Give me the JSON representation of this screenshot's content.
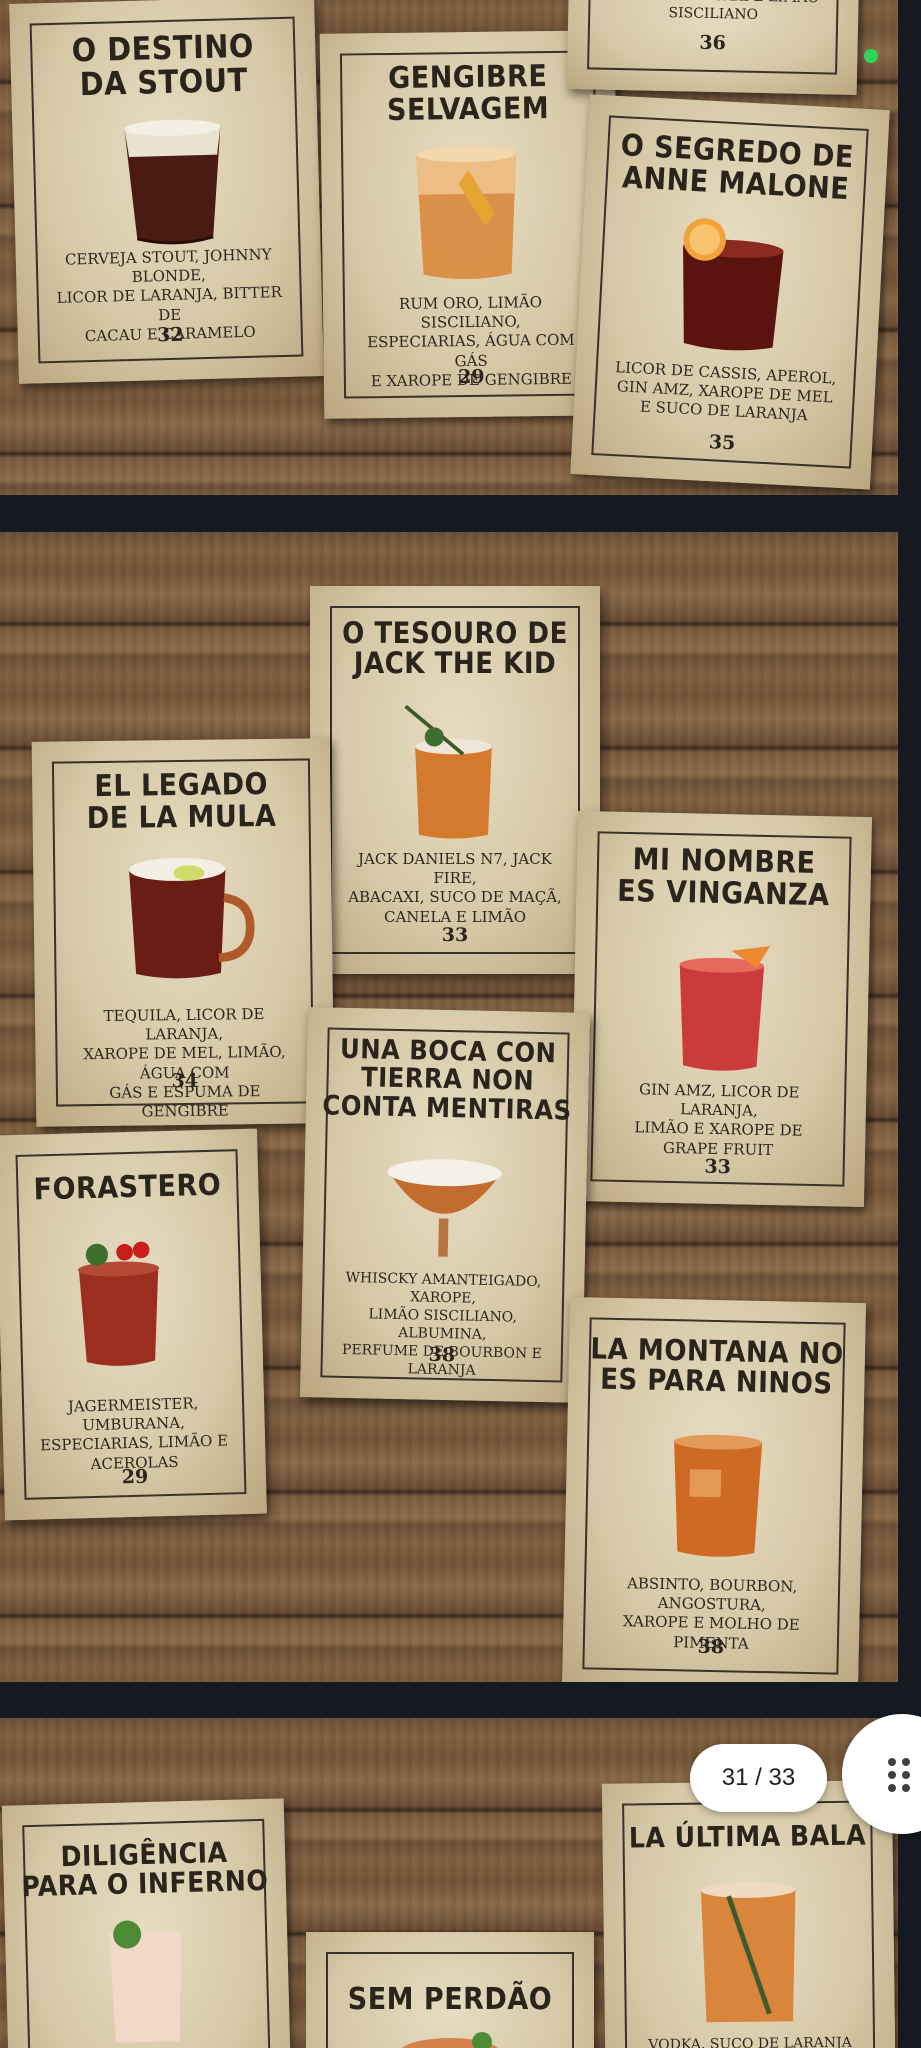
{
  "viewer": {
    "page_counter": "31 / 33",
    "accent_green": "#2fd35a",
    "background": "#151a21"
  },
  "pages": {
    "top": {
      "cards": [
        {
          "title": "O DESTINO\nDA STOUT",
          "ingredients": "CERVEJA STOUT, JOHNNY BLONDE,\nLICOR DE LARANJA, BITTER DE\nCACAU E CARAMELO",
          "price": "32",
          "drink_icon": "stout-glass-icon"
        },
        {
          "title": "GENGIBRE\nSELVAGEM",
          "ingredients": "RUM ORO, LIMÃO SISCILIANO,\nESPECIARIAS, ÁGUA COM GÁS\nE XAROPE DE GENGIBRE",
          "price": "29",
          "drink_icon": "ginger-cocktail-icon"
        },
        {
          "title": "",
          "ingredients": "SUCO DE ABACAXI E LIMÃO\nSISCILIANO",
          "price": "36",
          "drink_icon": ""
        },
        {
          "title": "O SEGREDO DE\nANNE MALONE",
          "ingredients": "LICOR DE CASSIS, APEROL,\nGIN AMZ, XAROPE DE MEL\nE SUCO DE LARANJA",
          "price": "35",
          "drink_icon": "negroni-glass-icon"
        }
      ]
    },
    "middle": {
      "cards": [
        {
          "title": "O TESOURO DE\nJACK THE KID",
          "ingredients": "JACK DANIELS N7, JACK FIRE,\nABACAXI, SUCO DE MAÇÃ,\nCANELA E LIMÃO",
          "price": "33",
          "drink_icon": "rosemary-cocktail-icon"
        },
        {
          "title": "EL LEGADO\nDE LA MULA",
          "ingredients": "TEQUILA, LICOR DE LARANJA,\nXAROPE DE MEL, LIMÃO, ÁGUA COM\nGÁS E ESPUMA DE GENGIBRE",
          "price": "34",
          "drink_icon": "copper-mug-icon"
        },
        {
          "title": "MI NOMBRE\nES VINGANZA",
          "ingredients": "GIN AMZ, LICOR DE LARANJA,\nLIMÃO E XAROPE DE\nGRAPE FRUIT",
          "price": "33",
          "drink_icon": "red-cocktail-icon"
        },
        {
          "title": "UNA BOCA CON\nTIERRA NON\nCONTA MENTIRAS",
          "ingredients": "WHISCKY AMANTEIGADO, XAROPE,\nLIMÃO SISCILIANO, ALBUMINA,\nPERFUME DE BOURBON E LARANJA",
          "price": "38",
          "drink_icon": "coupe-foam-icon"
        },
        {
          "title": "FORASTERO",
          "ingredients": "JAGERMEISTER, UMBURANA,\nESPECIARIAS, LIMÃO E\nACEROLAS",
          "price": "29",
          "drink_icon": "cherry-cocktail-icon"
        },
        {
          "title": "LA MONTANA NO\nES PARA NINOS",
          "ingredients": "ABSINTO, BOURBON, ANGOSTURA,\nXAROPE E MOLHO DE PIMENTA",
          "price": "38",
          "drink_icon": "amber-rocks-icon"
        }
      ]
    },
    "bottom": {
      "cards": [
        {
          "title": "DILIGÊNCIA\nPARA O INFERNO",
          "drink_icon": "mint-highball-icon"
        },
        {
          "title": "SEM PERDÃO",
          "drink_icon": "mint-cocktail-icon"
        },
        {
          "title": "LA ÚLTIMA BALA",
          "ingredients": "VODKA, SUCO DE LARANJA",
          "drink_icon": "herb-highball-icon"
        }
      ]
    }
  }
}
